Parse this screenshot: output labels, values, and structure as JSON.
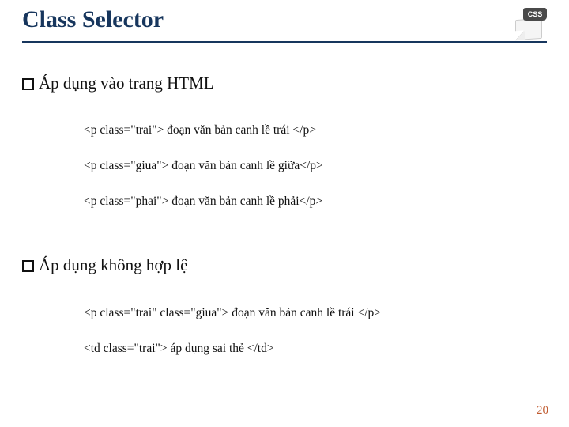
{
  "title": "Class Selector",
  "icon": {
    "badge_text": "CSS"
  },
  "sections": [
    {
      "heading": "Áp dụng vào trang HTML",
      "lines": [
        "<p class=\"trai\"> đoạn văn bản canh lề trái </p>",
        "<p class=\"giua\"> đoạn văn bản canh lề giữa</p>",
        "<p class=\"phai\"> đoạn văn bản canh lề phải</p>"
      ]
    },
    {
      "heading": "Áp dụng không hợp lệ",
      "lines": [
        "<p class=\"trai\" class=\"giua\"> đoạn văn bản canh lề trái </p>",
        "<td  class=\"trai\"> áp dụng sai thẻ </td>"
      ]
    }
  ],
  "page_number": "20"
}
